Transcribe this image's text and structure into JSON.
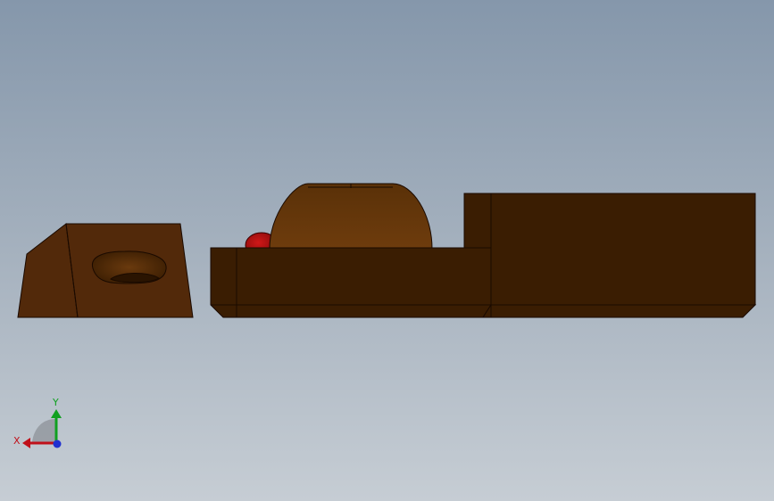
{
  "viewport": {
    "background_top": "#8597ab",
    "background_bottom": "#c6cdd4"
  },
  "model": {
    "color_dark": "#3a1d02",
    "color_mid": "#4a2706",
    "color_light": "#6a3b0f",
    "accent_red": "#b01010"
  },
  "triad": {
    "x_label": "X",
    "y_label": "Y",
    "x_color": "#c0101a",
    "y_color": "#10a020",
    "z_color": "#2030d0"
  }
}
